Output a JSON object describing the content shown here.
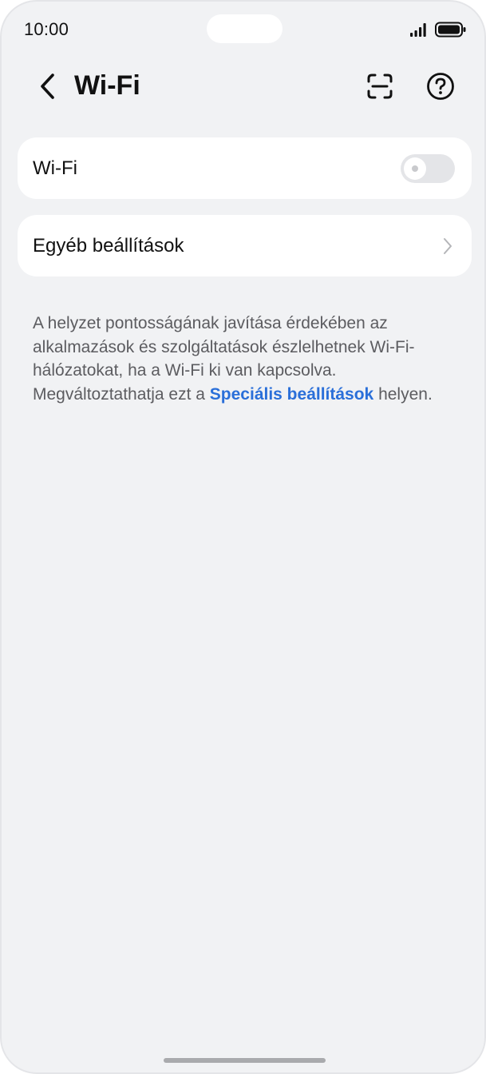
{
  "status_bar": {
    "time": "10:00",
    "signal_icon": "signal-bars-icon",
    "battery_icon": "battery-icon"
  },
  "header": {
    "title": "Wi-Fi",
    "back_icon": "chevron-left-icon",
    "scan_icon": "scan-icon",
    "help_icon": "help-circle-icon"
  },
  "wifi_card": {
    "label": "Wi-Fi",
    "toggle_state": "off"
  },
  "other_settings_card": {
    "label": "Egyéb beállítások",
    "chevron_icon": "chevron-right-icon"
  },
  "description": {
    "text_before": "A helyzet pontosságának javítása érdekében az alkalmazások és szolgáltatások észlelhetnek Wi-Fi-hálózatokat, ha a Wi-Fi ki van kapcsolva. Megváltoztathatja ezt a ",
    "link_text": "Speciális beállítások",
    "text_after": " helyen."
  },
  "colors": {
    "background": "#f1f2f4",
    "card": "#ffffff",
    "link": "#2a6fd9",
    "toggle_off_track": "#e4e5e8"
  }
}
